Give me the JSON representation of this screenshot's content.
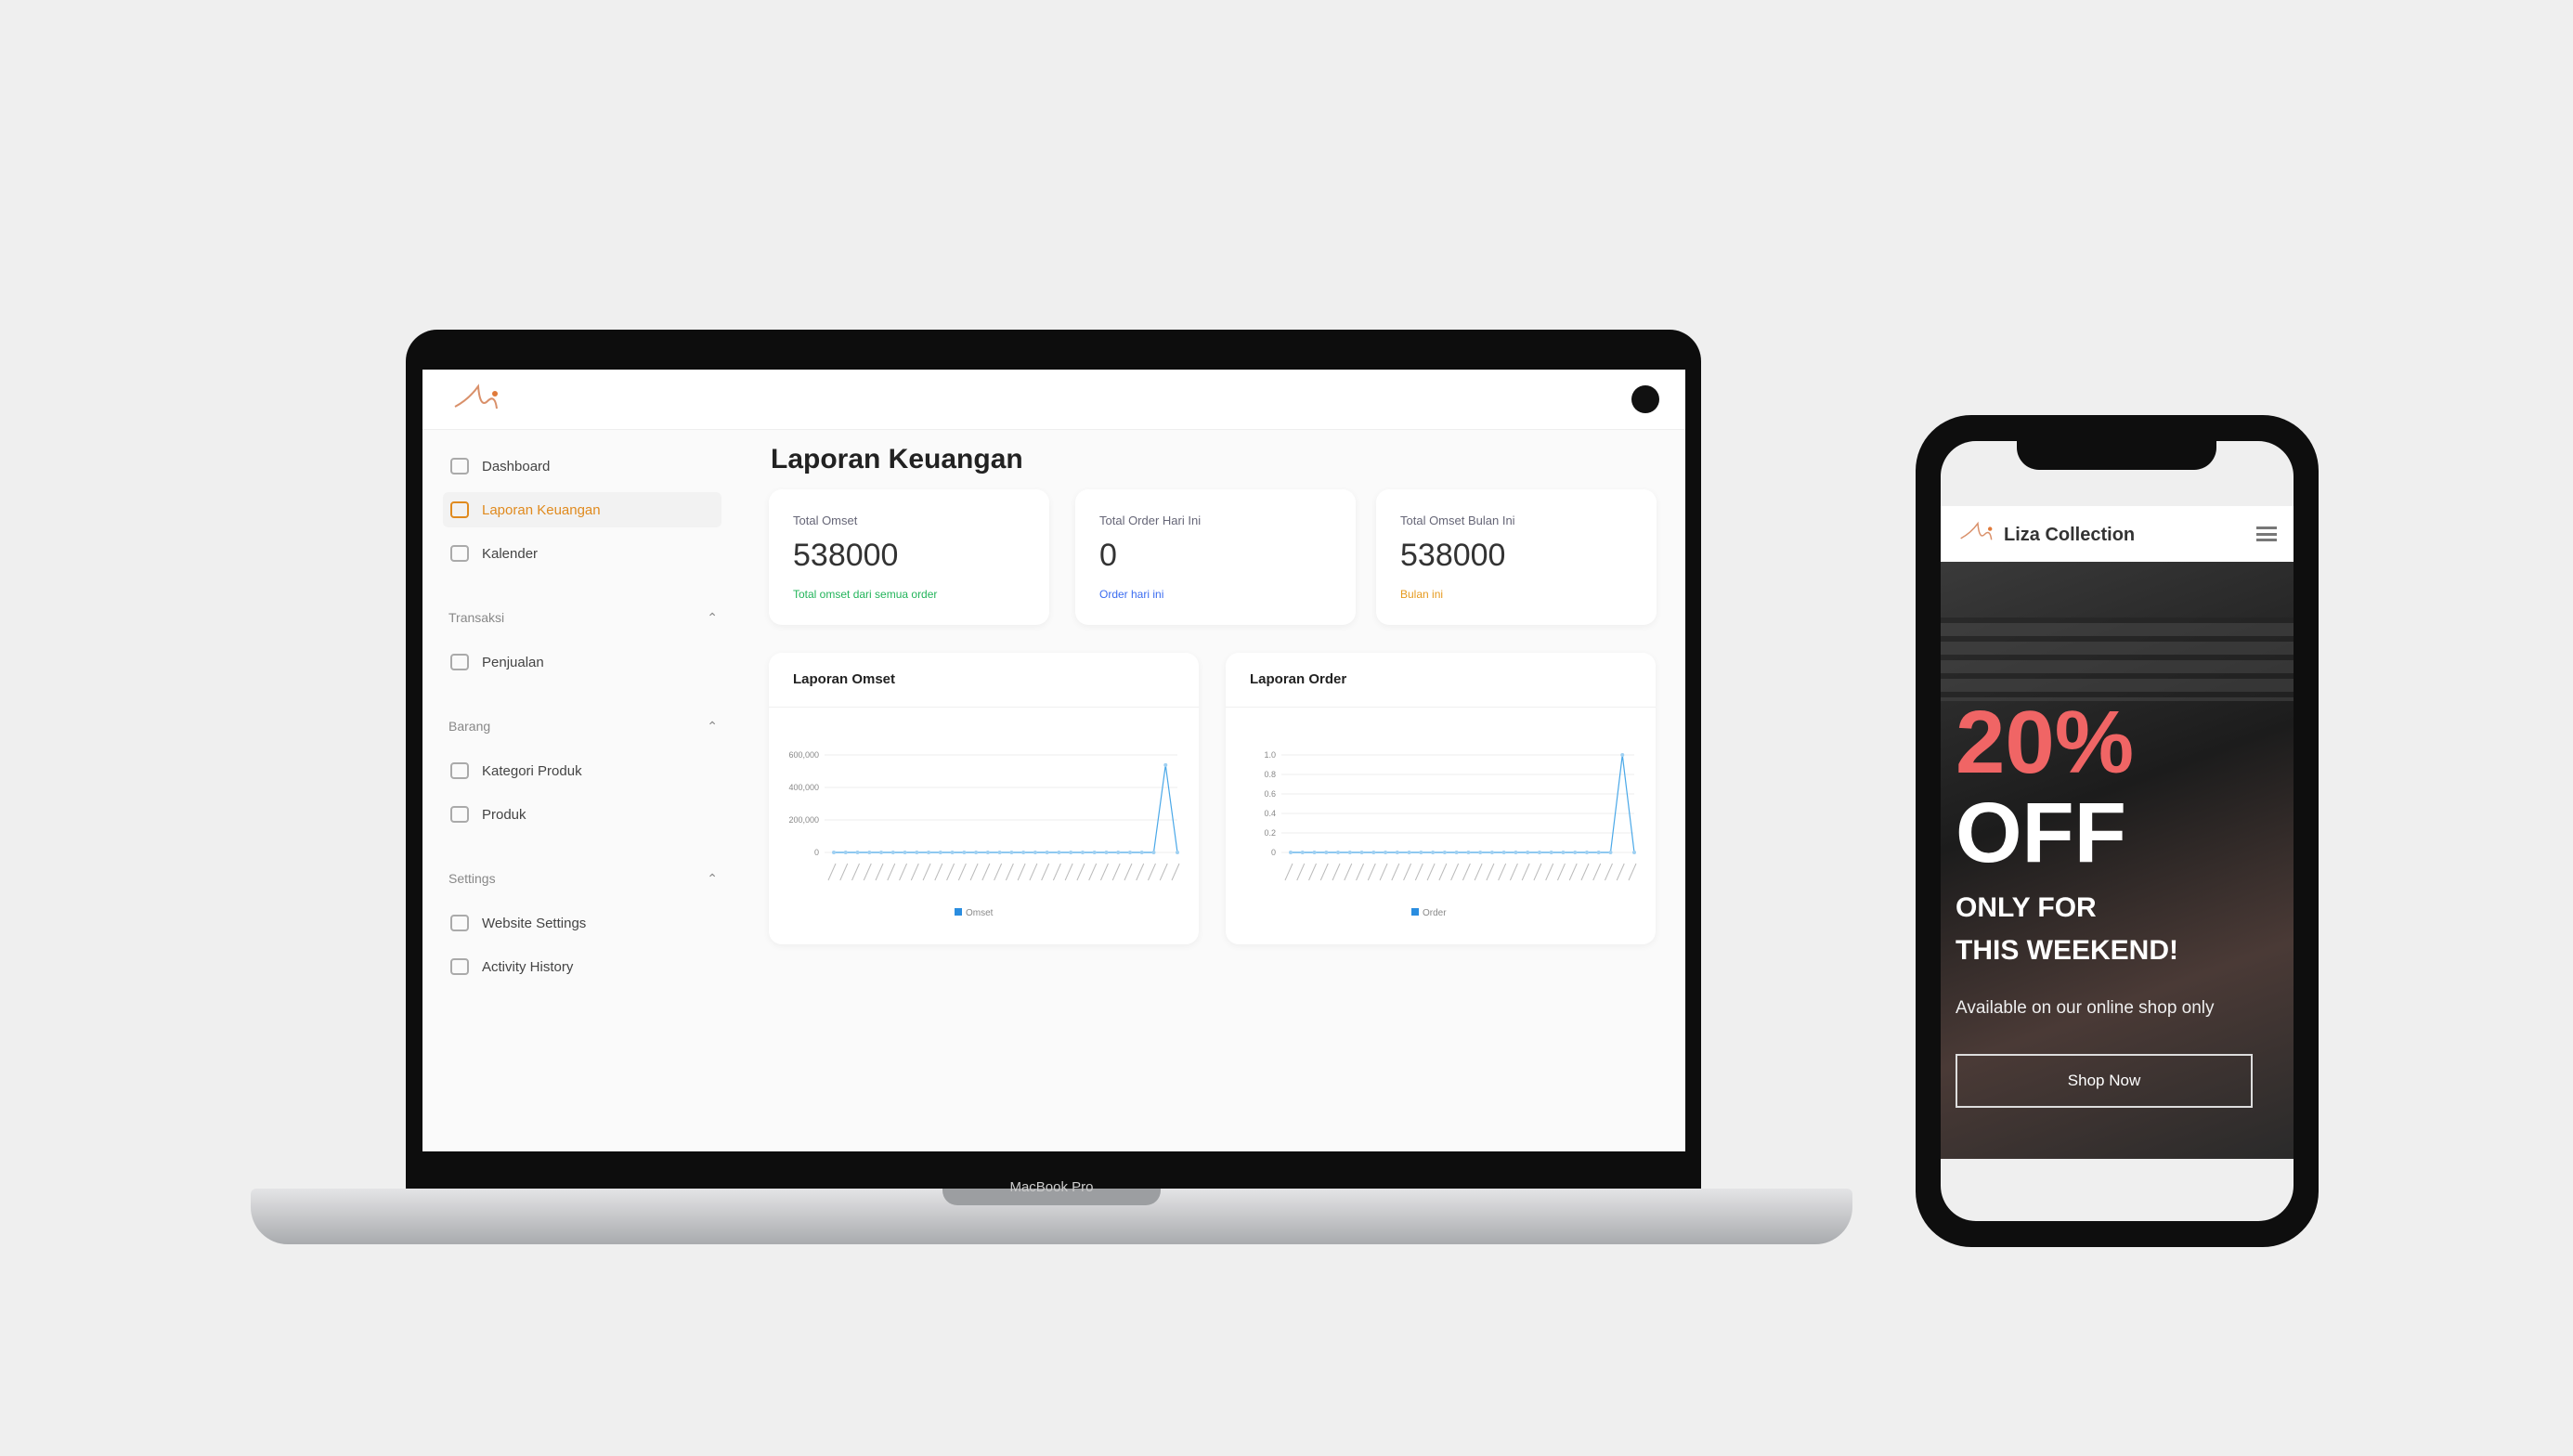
{
  "laptop": {
    "brand_label": "MacBook Pro",
    "sidebar": {
      "items": [
        {
          "label": "Dashboard",
          "icon": "home-icon"
        },
        {
          "label": "Laporan Keuangan",
          "icon": "bar-chart-icon",
          "active": true
        },
        {
          "label": "Kalender",
          "icon": "calendar-icon"
        }
      ],
      "sections": [
        {
          "title": "Transaksi",
          "items": [
            {
              "label": "Penjualan",
              "icon": "cart-icon"
            }
          ]
        },
        {
          "title": "Barang",
          "items": [
            {
              "label": "Kategori Produk",
              "icon": "box-icon"
            },
            {
              "label": "Produk",
              "icon": "bag-icon"
            }
          ]
        },
        {
          "title": "Settings",
          "items": [
            {
              "label": "Website Settings",
              "icon": "gear-icon"
            },
            {
              "label": "Activity History",
              "icon": "clock-icon"
            }
          ]
        }
      ]
    },
    "page_title": "Laporan Keuangan",
    "cards": [
      {
        "label": "Total Omset",
        "value": "538000",
        "sub": "Total omset dari semua order",
        "color": "#22b45a"
      },
      {
        "label": "Total Order Hari Ini",
        "value": "0",
        "sub": "Order hari ini",
        "color": "#3b6cf0"
      },
      {
        "label": "Total Omset Bulan Ini",
        "value": "538000",
        "sub": "Bulan ini",
        "color": "#e69a1e"
      }
    ],
    "charts": [
      {
        "title": "Laporan Omset",
        "legend": "Omset",
        "yticks": [
          "600,000",
          "400,000",
          "200,000",
          "0"
        ]
      },
      {
        "title": "Laporan Order",
        "legend": "Order",
        "yticks": [
          "1.0",
          "0.8",
          "0.6",
          "0.4",
          "0.2",
          "0"
        ]
      }
    ]
  },
  "phone": {
    "brand": "Liza Collection",
    "hero": {
      "headline1": "20%",
      "headline2": "OFF",
      "tagline1": "ONLY FOR",
      "tagline2": "THIS WEEKEND!",
      "subtitle": "Available on our online shop only",
      "button": "Shop Now"
    },
    "accent": "#f06565"
  },
  "chart_data": [
    {
      "type": "line",
      "title": "Laporan Omset",
      "series": [
        {
          "name": "Omset",
          "values": [
            0,
            0,
            0,
            0,
            0,
            0,
            0,
            0,
            0,
            0,
            0,
            0,
            0,
            0,
            0,
            0,
            0,
            0,
            0,
            0,
            0,
            0,
            0,
            0,
            0,
            0,
            0,
            0,
            538000,
            0
          ]
        }
      ],
      "ylim": [
        0,
        600000
      ]
    },
    {
      "type": "line",
      "title": "Laporan Order",
      "series": [
        {
          "name": "Order",
          "values": [
            0,
            0,
            0,
            0,
            0,
            0,
            0,
            0,
            0,
            0,
            0,
            0,
            0,
            0,
            0,
            0,
            0,
            0,
            0,
            0,
            0,
            0,
            0,
            0,
            0,
            0,
            0,
            0,
            1,
            0
          ]
        }
      ],
      "ylim": [
        0,
        1
      ]
    }
  ]
}
